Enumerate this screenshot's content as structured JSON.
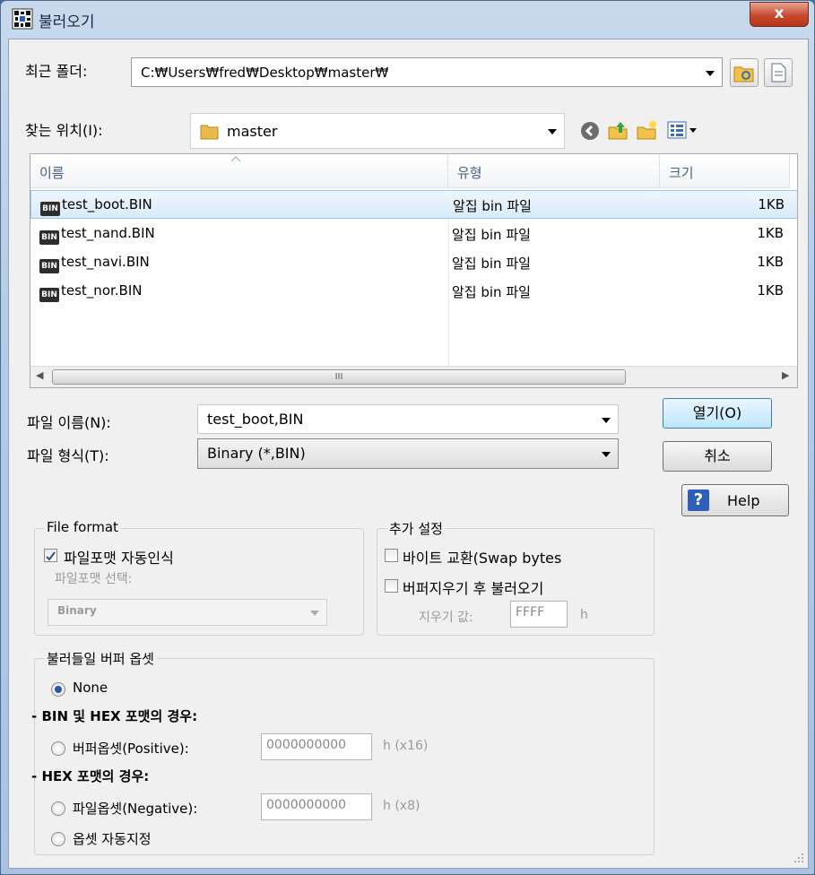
{
  "window": {
    "title": "불러오기",
    "close_label": "x"
  },
  "recent": {
    "label": "최근 폴더:",
    "path": "C:₩Users₩fred₩Desktop₩master₩"
  },
  "lookin": {
    "label": "찾는 위치(I):",
    "folder": "master"
  },
  "columns": {
    "name": "이름",
    "type": "유형",
    "size": "크기"
  },
  "files": [
    {
      "name": "test_boot.BIN",
      "type": "알집 bin 파일",
      "size": "1KB",
      "selected": true
    },
    {
      "name": "test_nand.BIN",
      "type": "알집 bin 파일",
      "size": "1KB",
      "selected": false
    },
    {
      "name": "test_navi.BIN",
      "type": "알집 bin 파일",
      "size": "1KB",
      "selected": false
    },
    {
      "name": "test_nor.BIN",
      "type": "알집 bin 파일",
      "size": "1KB",
      "selected": false
    }
  ],
  "file_icon_text": "BIN",
  "filename": {
    "label": "파일 이름(N):",
    "value": "test_boot,BIN"
  },
  "filetype": {
    "label": "파일 형식(T):",
    "value": "Binary (*,BIN)"
  },
  "buttons": {
    "open": "열기(O)",
    "cancel": "취소",
    "help": "Help",
    "help_icon": "?"
  },
  "file_format": {
    "title": "File format",
    "auto_label": "파일포맷 자동인식",
    "auto_checked": true,
    "select_label": "파일포맷 선택:",
    "select_value": "Binary"
  },
  "extra": {
    "title": "추가 설정",
    "swap_label": "바이트 교환(Swap bytes",
    "clear_label": "버퍼지우기 후 불러오기",
    "fill_label": "지우기 값:",
    "fill_value": "FFFF",
    "fill_suffix": "h"
  },
  "offset": {
    "title": "불러들일 버퍼 옵셋",
    "none_label": "None",
    "binhex_header": "- BIN 및 HEX  포맷의 경우:",
    "positive_label": "버퍼옵셋(Positive):",
    "positive_value": "0000000000",
    "positive_suffix": "h (x16)",
    "hex_header": "- HEX 포맷의 경우:",
    "negative_label": "파일옵셋(Negative):",
    "negative_value": "0000000000",
    "negative_suffix": "h (x8)",
    "auto_label": "옵셋 자동지정"
  },
  "scroll_grip": "III",
  "colors": {
    "titlebar": "#b3cbe6",
    "selection": "#d8ebfa",
    "close": "#c64a2e"
  }
}
